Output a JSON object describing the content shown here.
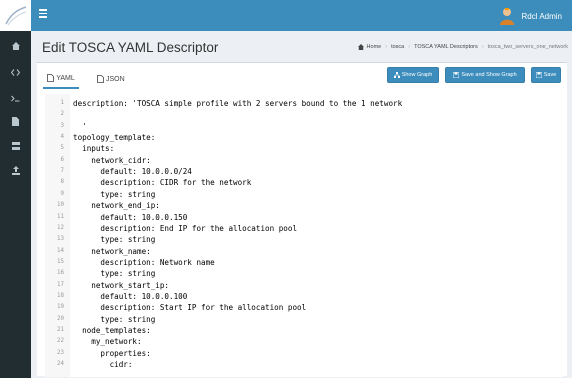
{
  "topbar": {
    "user_name": "Rdcl Admin"
  },
  "header": {
    "title": "Edit TOSCA YAML Descriptor",
    "breadcrumb": [
      "Home",
      "tosca",
      "TOSCA YAML Descriptors",
      "tosca_two_servers_one_network"
    ]
  },
  "tabs": [
    {
      "label": "YAML",
      "active": true
    },
    {
      "label": "JSON",
      "active": false
    }
  ],
  "toolbar": {
    "show_graph": "Show Graph",
    "save_and_show_graph": "Save and Show Graph",
    "save": "Save"
  },
  "editor": {
    "lines": [
      "description: 'TOSCA simple profile with 2 servers bound to the 1 network",
      "",
      "  '",
      "topology_template:",
      "  inputs:",
      "    network_cidr:",
      "      default: 10.0.0.0/24",
      "      description: CIDR for the network",
      "      type: string",
      "    network_end_ip:",
      "      default: 10.0.0.150",
      "      description: End IP for the allocation pool",
      "      type: string",
      "    network_name:",
      "      description: Network name",
      "      type: string",
      "    network_start_ip:",
      "      default: 10.0.0.100",
      "      description: Start IP for the allocation pool",
      "      type: string",
      "  node_templates:",
      "    my_network:",
      "      properties:",
      "        cidr:"
    ]
  },
  "sidebar": {
    "icons": [
      "dashboard-icon",
      "code-icon",
      "terminal-icon",
      "file-icon",
      "server-icon",
      "upload-icon"
    ]
  },
  "colors": {
    "primary": "#3c8dbc",
    "sidebar": "#222d32",
    "background": "#ecf0f5"
  }
}
